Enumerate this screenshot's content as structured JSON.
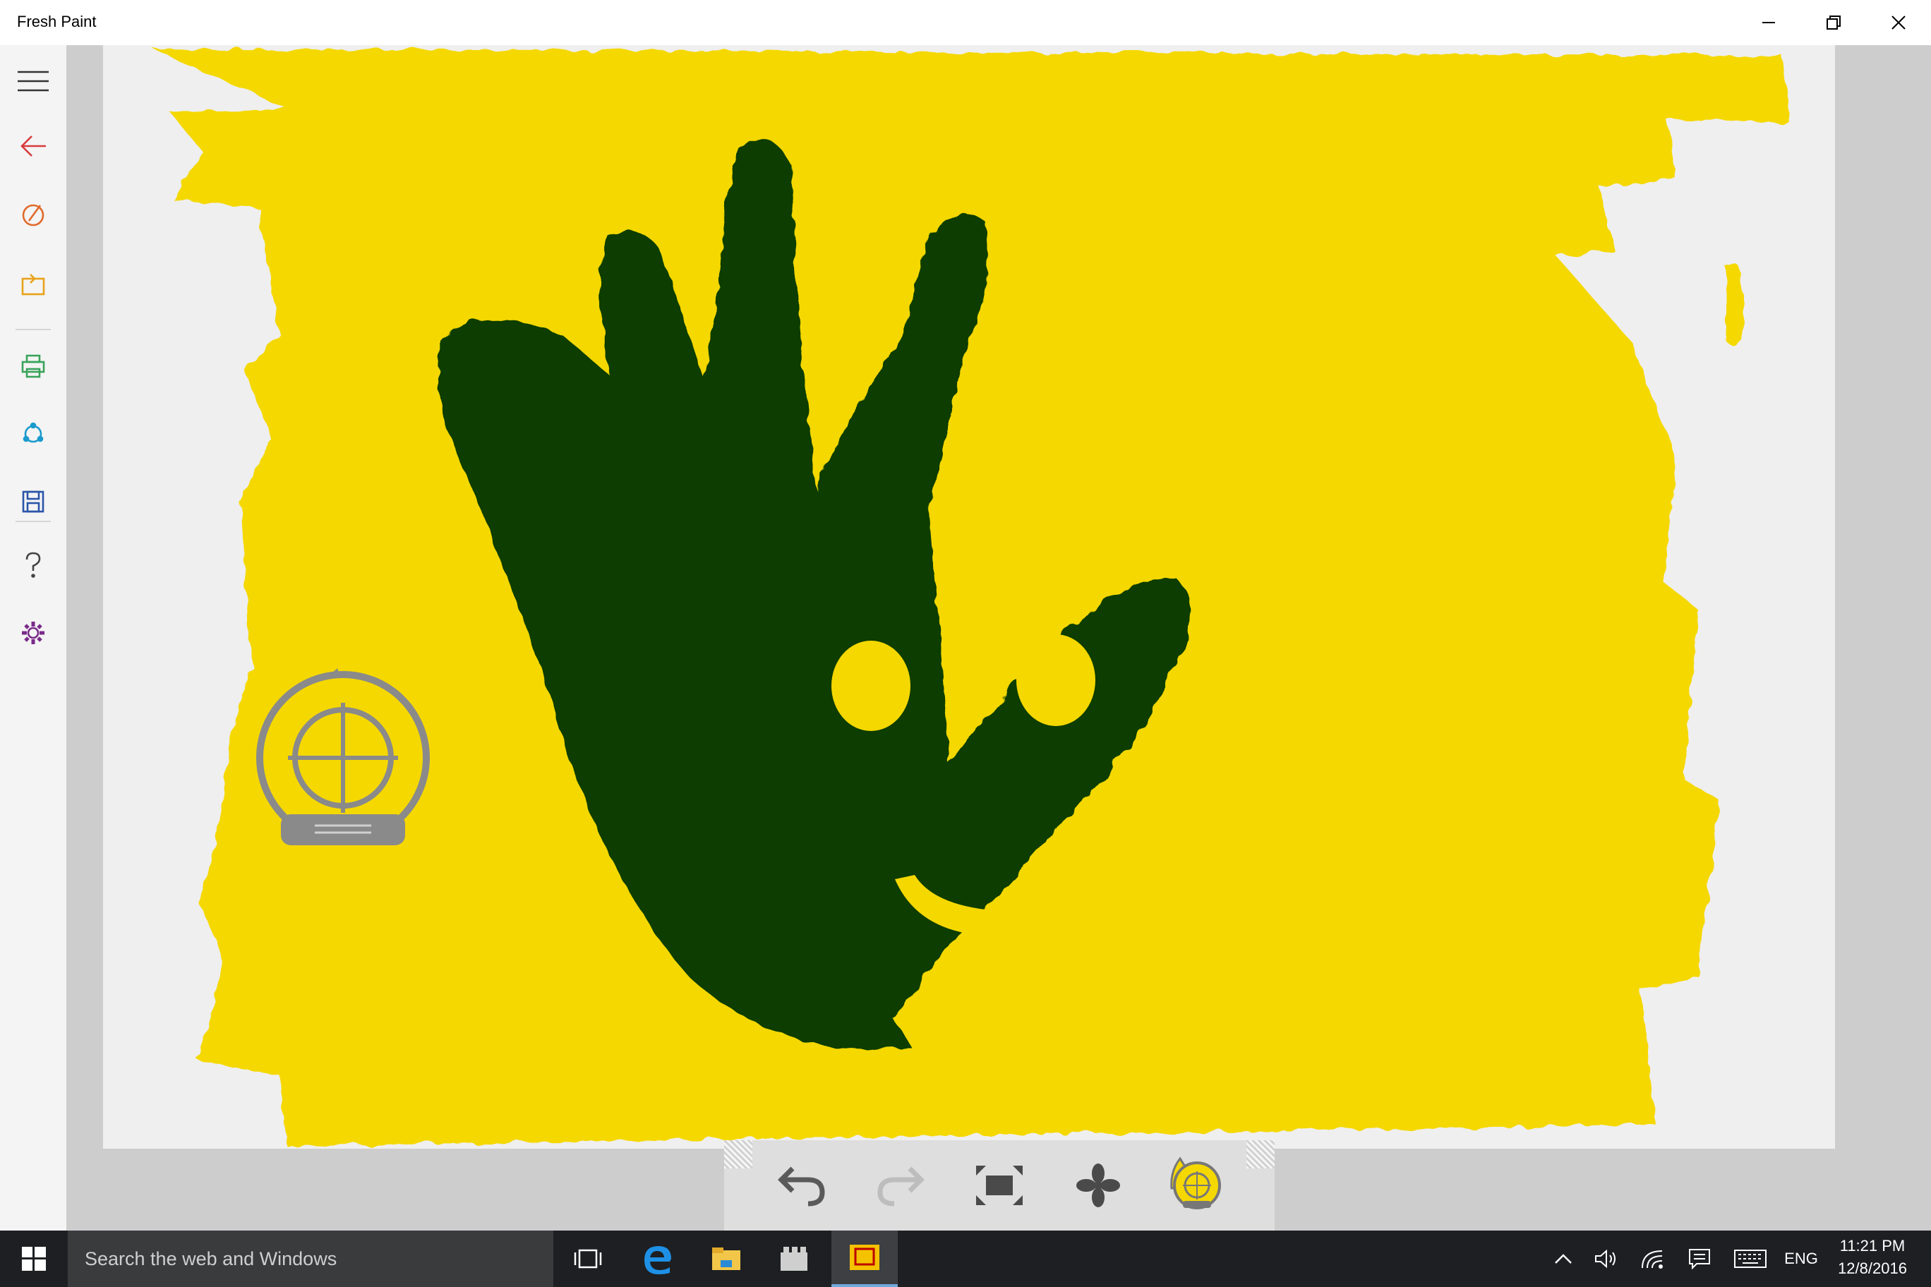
{
  "window": {
    "title": "Fresh Paint",
    "controls": [
      "minimize",
      "restore",
      "close"
    ]
  },
  "sidebar": {
    "items": [
      {
        "name": "menu",
        "icon": "hamburger-icon"
      },
      {
        "name": "back",
        "icon": "back-arrow-icon",
        "color": "#d83b3b"
      },
      {
        "name": "new-painting",
        "icon": "palette-brush-icon",
        "color": "#e06a2c"
      },
      {
        "name": "import",
        "icon": "import-icon",
        "color": "#e8a21a"
      },
      {
        "name": "print",
        "icon": "printer-icon",
        "color": "#3aa35a"
      },
      {
        "name": "share",
        "icon": "share-icon",
        "color": "#1a9bcd"
      },
      {
        "name": "save",
        "icon": "save-icon",
        "color": "#2b55a8"
      },
      {
        "name": "help",
        "icon": "question-icon",
        "color": "#444444"
      },
      {
        "name": "settings",
        "icon": "gear-icon",
        "color": "#7a2a8a"
      }
    ]
  },
  "canvas": {
    "paint_color": "#f5d800",
    "hand_color": "#0a3d05",
    "paper_color": "#efefef",
    "stencil_tool": "pan-target-icon"
  },
  "toolbar": {
    "items": [
      {
        "name": "undo",
        "icon": "undo-icon",
        "enabled": true
      },
      {
        "name": "redo",
        "icon": "redo-icon",
        "enabled": false
      },
      {
        "name": "fit-to-screen",
        "icon": "fit-screen-icon",
        "enabled": true
      },
      {
        "name": "dry",
        "icon": "fan-icon",
        "enabled": true
      },
      {
        "name": "pan",
        "icon": "pan-target-icon",
        "enabled": true
      }
    ]
  },
  "taskbar": {
    "search_placeholder": "Search the web and Windows",
    "time": "11:21 PM",
    "date": "12/8/2016",
    "language": "ENG"
  }
}
